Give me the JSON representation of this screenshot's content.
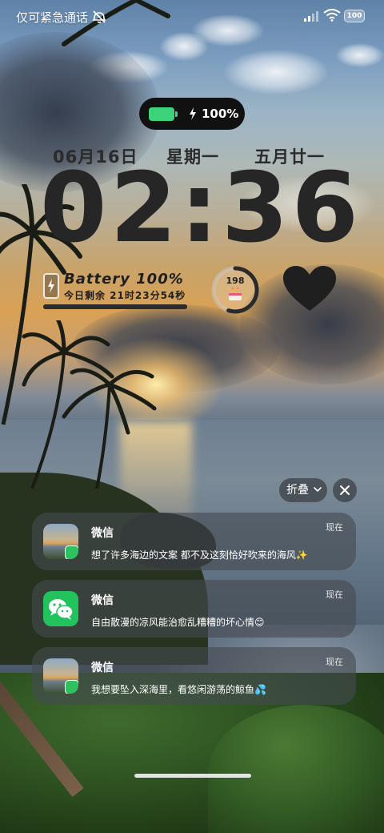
{
  "status_bar": {
    "carrier_text": "仅可紧急通话",
    "battery_badge": "100",
    "icons": [
      "mute-icon",
      "signal-icon",
      "wifi-icon",
      "battery-icon"
    ]
  },
  "charging": {
    "percent_label": "100%",
    "level": 1.0,
    "color": "#3dd37a"
  },
  "date": {
    "month_day": "06月16日",
    "weekday": "星期一",
    "lunar": "五月廿一"
  },
  "clock": {
    "time": "02:36"
  },
  "battery_widget": {
    "title": "Battery 100%",
    "remaining": "今日剩余 21时23分54秒",
    "day_progress": 1.0
  },
  "days_widget": {
    "count": "198",
    "ring_progress": 0.55
  },
  "fold_controls": {
    "fold_label": "折叠"
  },
  "notifications": [
    {
      "app": "微信",
      "time": "现在",
      "message": "想了许多海边的文案 都不及这刻恰好吹来的海风✨",
      "icon": "photo-avatar-with-wechat-badge"
    },
    {
      "app": "微信",
      "time": "现在",
      "message": "自由散漫的凉风能治愈乱糟糟的坏心情😊",
      "icon": "wechat-icon"
    },
    {
      "app": "微信",
      "time": "现在",
      "message": "我想要坠入深海里，看悠闲游荡的鲸鱼💦",
      "icon": "photo-avatar-with-wechat-badge"
    }
  ]
}
